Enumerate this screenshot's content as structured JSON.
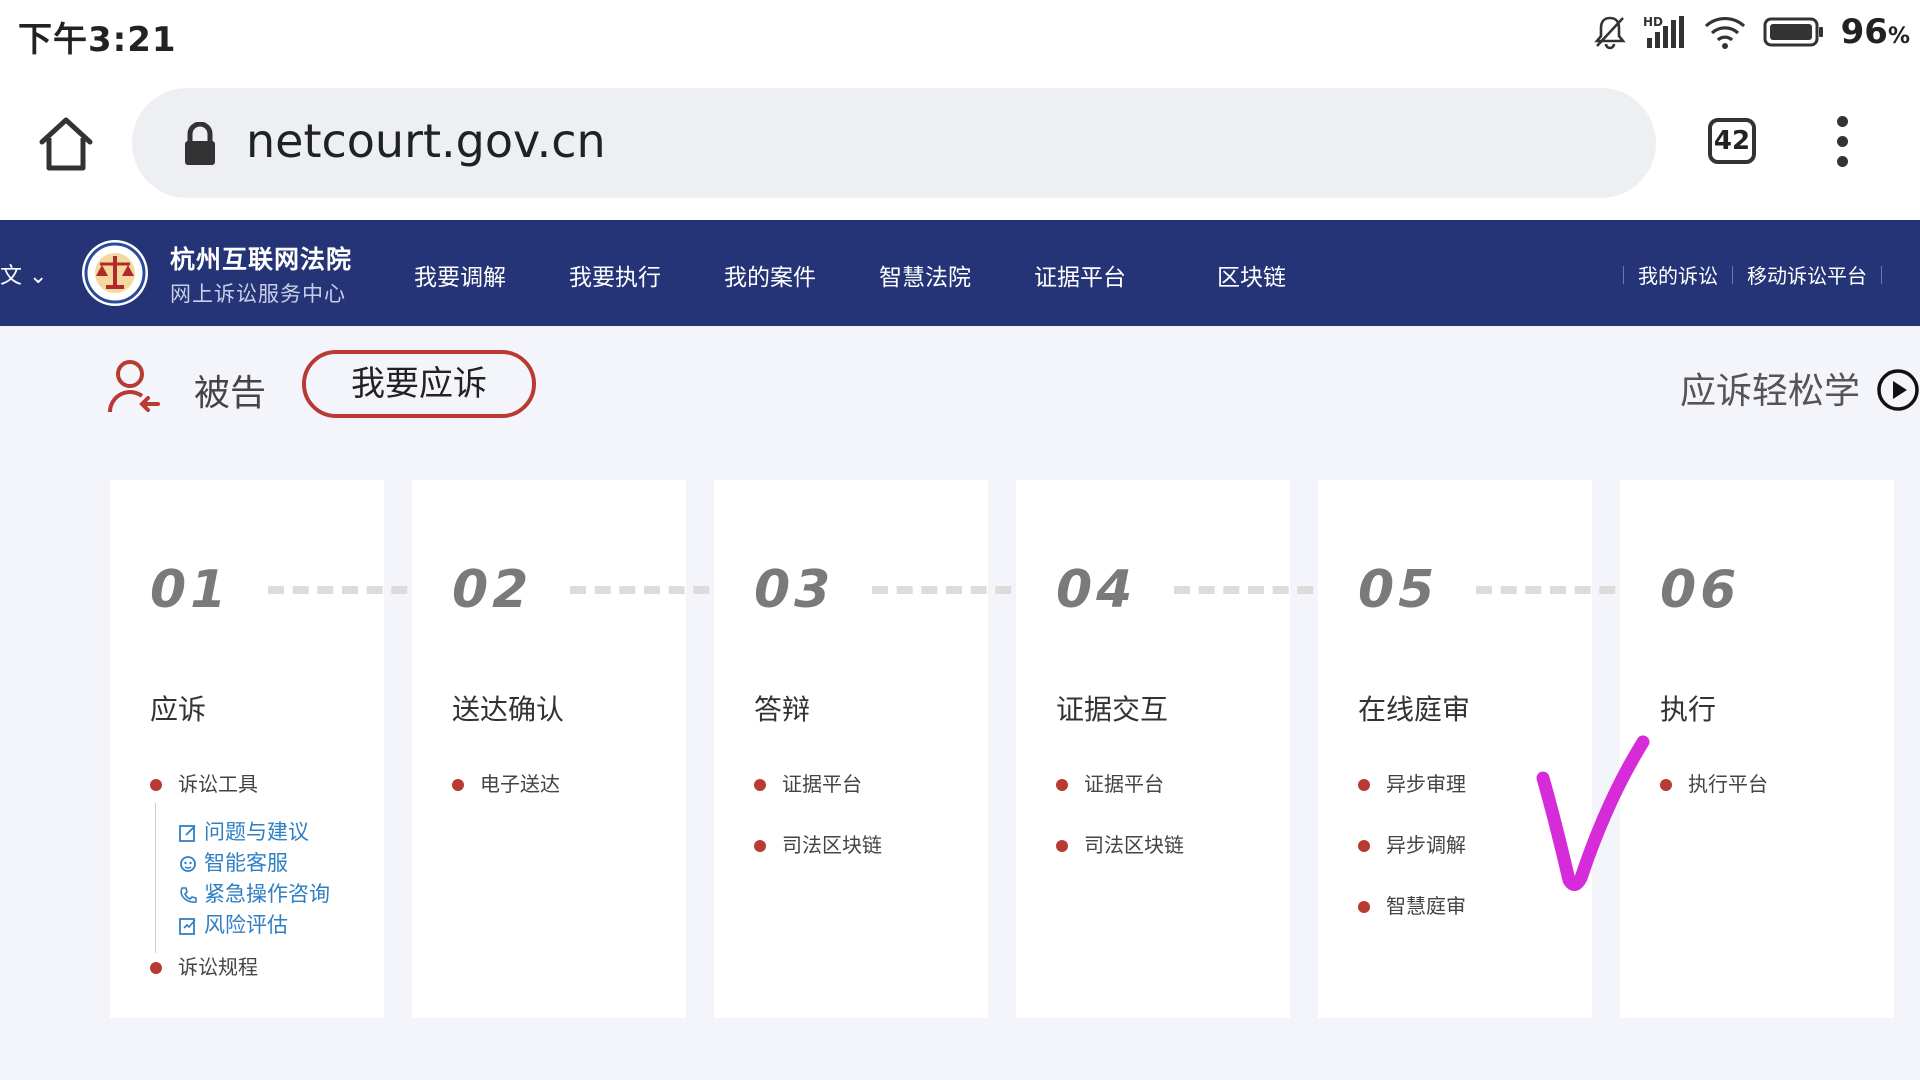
{
  "status_bar": {
    "time": "下午3:21",
    "battery": "96",
    "battery_unit": "%",
    "icons": [
      "mute-bell-icon",
      "hd-signal-icon",
      "wifi-icon",
      "battery-icon"
    ]
  },
  "browser": {
    "url": "netcourt.gov.cn",
    "tab_count": "42"
  },
  "site_nav": {
    "lang": "文",
    "org_name": "杭州互联网法院",
    "org_sub": "网上诉讼服务中心",
    "items": [
      "我要调解",
      "我要执行",
      "我的案件",
      "智慧法院",
      "证据平台",
      "区块链"
    ],
    "right_items": [
      "我的诉讼",
      "移动诉讼平台"
    ]
  },
  "role_bar": {
    "role": "被告",
    "respond_button": "我要应诉",
    "learn_link": "应诉轻松学"
  },
  "steps": [
    {
      "num": "01",
      "title": "应诉",
      "items": [
        "诉讼工具"
      ],
      "tools": [
        "问题与建议",
        "智能客服",
        "紧急操作咨询",
        "风险评估"
      ],
      "items_after": [
        "诉讼规程"
      ]
    },
    {
      "num": "02",
      "title": "送达确认",
      "items": [
        "电子送达"
      ]
    },
    {
      "num": "03",
      "title": "答辩",
      "items": [
        "证据平台",
        "司法区块链"
      ]
    },
    {
      "num": "04",
      "title": "证据交互",
      "items": [
        "证据平台",
        "司法区块链"
      ]
    },
    {
      "num": "05",
      "title": "在线庭审",
      "items": [
        "异步审理",
        "异步调解",
        "智慧庭审"
      ]
    },
    {
      "num": "06",
      "title": "执行",
      "items": [
        "执行平台"
      ]
    }
  ],
  "colors": {
    "nav_bg": "#243477",
    "accent_red": "#b93a33",
    "link_blue": "#2f7fc4",
    "annotation_magenta": "#d52bd8"
  }
}
